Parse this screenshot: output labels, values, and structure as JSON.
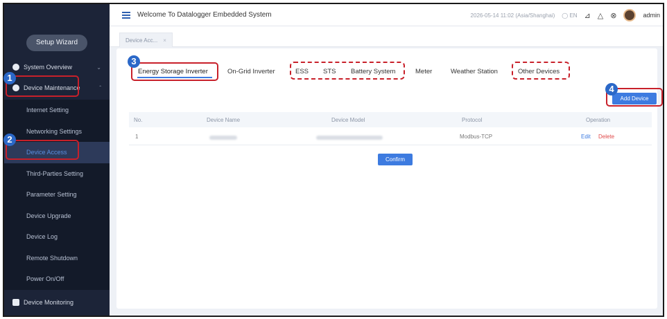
{
  "header": {
    "title": "Welcome To Datalogger Embedded System",
    "datetime": "2026-05-14 11:02 (Asia/Shanghai)",
    "language": "EN",
    "user": "admin"
  },
  "sidebar": {
    "wizard": "Setup Wizard",
    "groups": {
      "overview": "System Overview",
      "maintenance": "Device Maintenance",
      "monitoring": "Device Monitoring"
    },
    "items": [
      "Internet Setting",
      "Networking Settings",
      "Device Access",
      "Third-Parties Setting",
      "Parameter Setting",
      "Device Upgrade",
      "Device Log",
      "Remote Shutdown",
      "Power On/Off"
    ]
  },
  "page_tab": {
    "label": "Device Acc...",
    "close": "×"
  },
  "device_tabs": [
    "Energy Storage Inverter",
    "On-Grid Inverter",
    "ESS",
    "STS",
    "Battery System",
    "Meter",
    "Weather Station",
    "Other Devices"
  ],
  "actions": {
    "add_device": "Add Device",
    "confirm": "Confirm"
  },
  "table": {
    "headers": [
      "No.",
      "Device Name",
      "Device Model",
      "Protocol",
      "Operation"
    ],
    "rows": [
      {
        "no": "1",
        "protocol": "Modbus-TCP",
        "edit": "Edit",
        "delete": "Delete"
      }
    ]
  },
  "callouts": [
    "1",
    "2",
    "3",
    "4"
  ],
  "colors": {
    "accent": "#3d7be0",
    "highlight": "#c8202a",
    "sidebar": "#1c2438",
    "badge": "#2b68c8"
  }
}
